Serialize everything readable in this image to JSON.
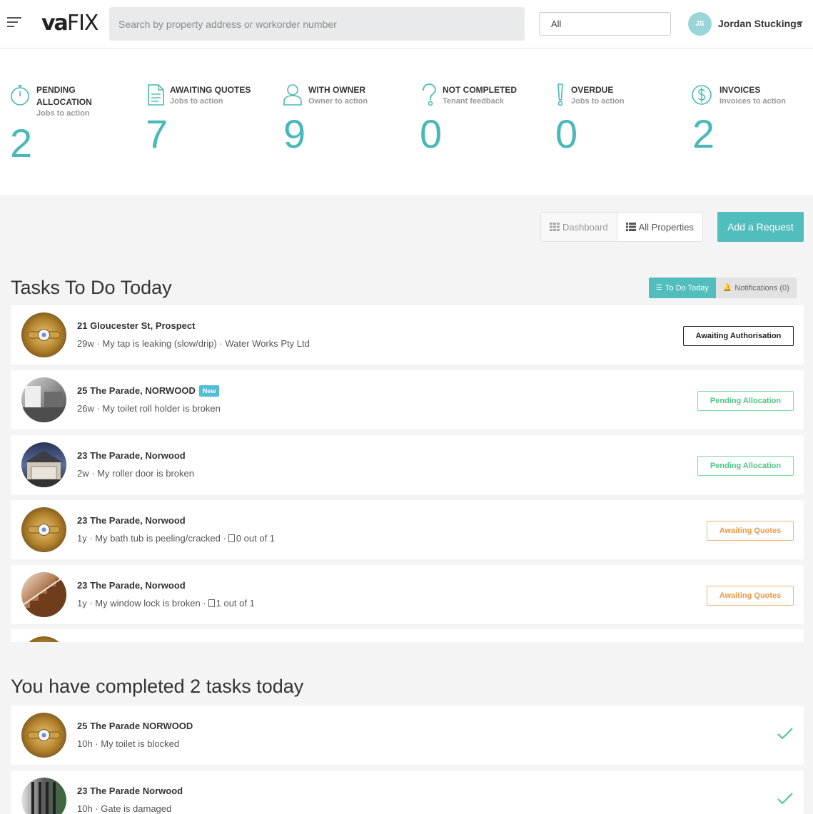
{
  "header": {
    "logo_va": "va",
    "logo_fix": "FIX",
    "search_placeholder": "Search by property address or workorder number",
    "filter_value": "All",
    "user_initials": "JS",
    "user_name": "Jordan Stuckings"
  },
  "stats": [
    {
      "title": "PENDING ALLOCATION",
      "sub": "Jobs to action",
      "value": "2",
      "icon": "stopwatch-icon"
    },
    {
      "title": "AWAITING QUOTES",
      "sub": "Jobs to action",
      "value": "7",
      "icon": "document-icon"
    },
    {
      "title": "WITH OWNER",
      "sub": "Owner to action",
      "value": "9",
      "icon": "person-icon"
    },
    {
      "title": "NOT COMPLETED",
      "sub": "Tenant feedback",
      "value": "0",
      "icon": "question-icon"
    },
    {
      "title": "OVERDUE",
      "sub": "Jobs to action",
      "value": "0",
      "icon": "exclamation-icon"
    },
    {
      "title": "INVOICES",
      "sub": "Invoices to action",
      "value": "2",
      "icon": "dollar-icon"
    }
  ],
  "toolbar": {
    "dashboard": "Dashboard",
    "all_properties": "All Properties",
    "add_request": "Add a Request"
  },
  "tasks_section": {
    "title": "Tasks To Do Today",
    "tab_todo": "To Do Today",
    "tab_notifications": "Notifications (0)"
  },
  "tasks": [
    {
      "address": "21 Gloucester St, Prospect",
      "desc": "29w · My tap is leaking (slow/drip) · Water Works Pty Ltd",
      "status": "Awaiting Authorisation",
      "status_type": "auth",
      "thumb": "tap"
    },
    {
      "address": "25 The Parade, NORWOOD",
      "badge": "New",
      "desc": "26w · My toilet roll holder is broken",
      "status": "Pending Allocation",
      "status_type": "pending",
      "thumb": "kitchen"
    },
    {
      "address": "23 The Parade, Norwood",
      "desc": "2w · My roller door is broken",
      "status": "Pending Allocation",
      "status_type": "pending",
      "thumb": "house"
    },
    {
      "address": "23 The Parade, Norwood",
      "desc": "1y · My bath tub is peeling/cracked ·",
      "quote": "0 out of 1",
      "status": "Awaiting Quotes",
      "status_type": "quotes",
      "thumb": "tap"
    },
    {
      "address": "23 The Parade, Norwood",
      "desc": "1y · My window lock is broken ·",
      "quote": "1 out of 1",
      "status": "Awaiting Quotes",
      "status_type": "quotes",
      "thumb": "stairs"
    }
  ],
  "completed_section": {
    "title": "You have completed 2 tasks today"
  },
  "completed": [
    {
      "address": "25 The Parade NORWOOD",
      "desc": "10h · My toilet is blocked",
      "thumb": "tap"
    },
    {
      "address": "23 The Parade Norwood",
      "desc": "10h · Gate is damaged",
      "thumb": "gate"
    }
  ],
  "colors": {
    "accent": "#52bdbd",
    "stat_number": "#4ab8b8",
    "pending": "#4cc683",
    "quotes": "#e89a48"
  }
}
